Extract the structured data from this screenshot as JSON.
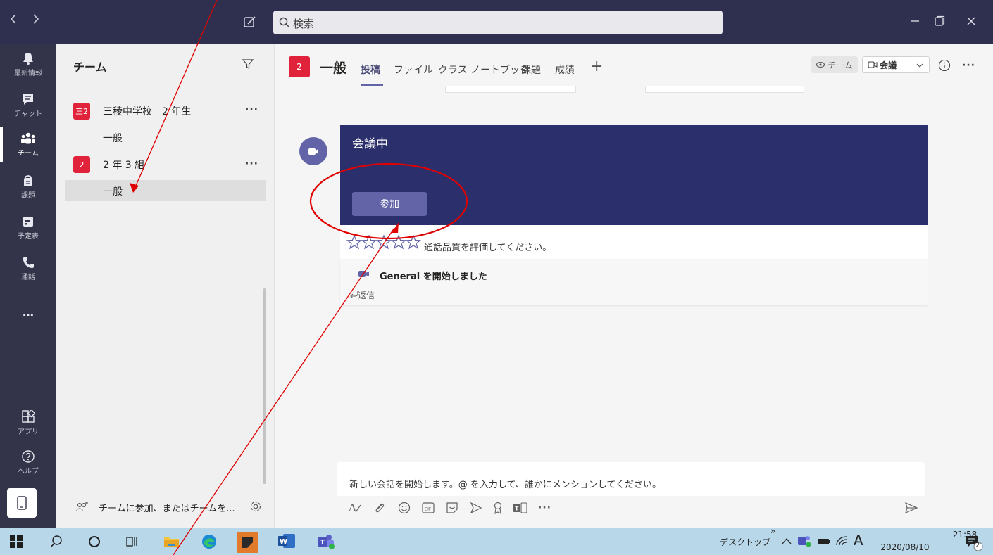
{
  "search": {
    "placeholder": "検索"
  },
  "rail": {
    "items": [
      {
        "label": "最新情報",
        "icon": "bell-icon"
      },
      {
        "label": "チャット",
        "icon": "chat-icon"
      },
      {
        "label": "チーム",
        "icon": "teams-icon"
      },
      {
        "label": "課題",
        "icon": "assignments-icon"
      },
      {
        "label": "予定表",
        "icon": "calendar-icon"
      },
      {
        "label": "通話",
        "icon": "phone-icon"
      },
      {
        "label": "…",
        "icon": "more-icon"
      },
      {
        "label": "アプリ",
        "icon": "apps-icon"
      },
      {
        "label": "ヘルプ",
        "icon": "help-icon"
      }
    ]
  },
  "teams_panel": {
    "title": "チーム",
    "teams": [
      {
        "badge": "三2",
        "name": "三稜中学校　2 年生",
        "channel": "一般"
      },
      {
        "badge": "2",
        "name": "2 年 3 組",
        "channel": "一般"
      }
    ],
    "join_label": "チームに参加、またはチームを..."
  },
  "channel": {
    "badge": "2",
    "name": "一般",
    "tabs": [
      "投稿",
      "ファイル",
      "クラス ノートブック",
      "課題",
      "成績"
    ],
    "add_tab": "+",
    "team_button": "チーム",
    "meet_button": "会議"
  },
  "meeting": {
    "title": "会議中",
    "join_label": "参加",
    "rate_text": "通話品質を評価してください。",
    "started_text": "General を開始しました",
    "reply_label": "返信"
  },
  "compose": {
    "placeholder": "新しい会話を開始します。@ を入力して、誰かにメンションしてください。"
  },
  "taskbar": {
    "desktop_label": "デスクトップ",
    "chevron": "»",
    "ime": "A",
    "time": "21:58",
    "date": "2020/08/10",
    "notification_count": "2"
  },
  "colors": {
    "titlebar": "#2f2f4f",
    "rail": "#33344a",
    "accent": "#6264a7",
    "meeting_card": "#2b2f6b",
    "team_badge": "#e0223b",
    "annotation": "#e00000",
    "taskbar": "#b8d7e8"
  }
}
